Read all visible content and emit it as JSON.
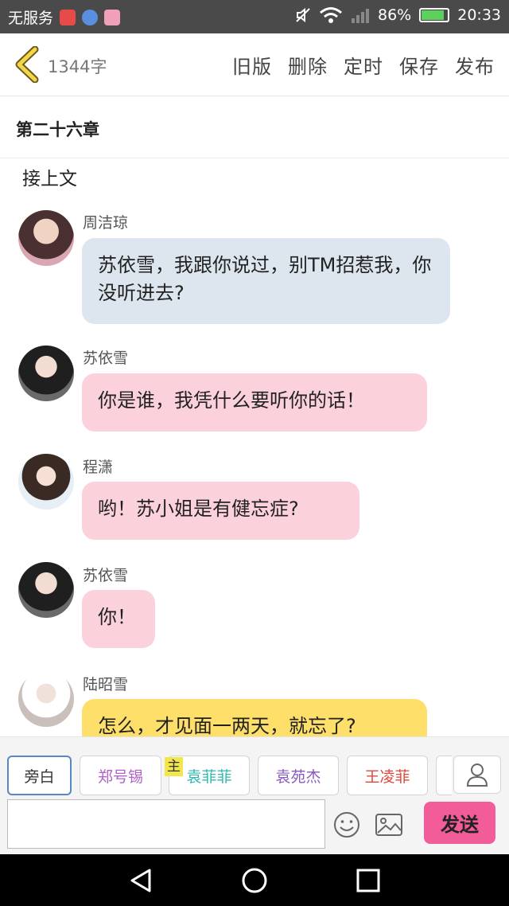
{
  "status_bar": {
    "carrier": "无服务",
    "battery": "86%",
    "battery_level": 0.86,
    "time": "20:33"
  },
  "header": {
    "word_count": "1344字",
    "actions": [
      "旧版",
      "删除",
      "定时",
      "保存",
      "发布"
    ]
  },
  "chapter": {
    "title": "第二十六章"
  },
  "intro": "接上文",
  "messages": [
    {
      "speaker": "周洁琼",
      "text": "苏依雪，我跟你说过，别TM招惹我，你没听进去?",
      "bubble_color": "#dde5ef"
    },
    {
      "speaker": "苏依雪",
      "text": "你是谁，我凭什么要听你的话！",
      "bubble_color": "#fbd1dc"
    },
    {
      "speaker": "程潇",
      "text": "哟！苏小姐是有健忘症?",
      "bubble_color": "#fbd1dc"
    },
    {
      "speaker": "苏依雪",
      "text": "你！",
      "bubble_color": "#fbd1dc"
    },
    {
      "speaker": "陆昭雪",
      "text": "怎么，才见面一两天，就忘了?",
      "bubble_color": "#fddf6a"
    }
  ],
  "roles": [
    {
      "name": "旁白",
      "color": "#333333"
    },
    {
      "name": "郑号锡",
      "color": "#b062c9"
    },
    {
      "name": "袁菲菲",
      "color": "#2fb8b0"
    },
    {
      "name": "袁苑杰",
      "color": "#8a5ac2"
    },
    {
      "name": "王凌菲",
      "color": "#e0463c"
    }
  ],
  "main_tag": "主",
  "input": {
    "placeholder": ""
  },
  "send_label": "发送"
}
